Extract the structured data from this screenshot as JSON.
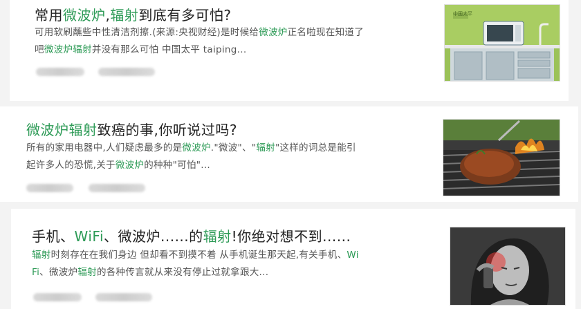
{
  "articles": [
    {
      "title_parts": [
        {
          "t": "常用",
          "hl": false
        },
        {
          "t": "微波炉",
          "hl": true
        },
        {
          "t": ",",
          "hl": false
        },
        {
          "t": "辐射",
          "hl": true
        },
        {
          "t": "到底有多可怕?",
          "hl": false
        }
      ],
      "snippet_lines": [
        [
          {
            "t": "可用软刷蘸些中性清洁剂擦.(来源:央视财经)是时候给",
            "hl": false
          },
          {
            "t": "微波炉",
            "hl": true
          },
          {
            "t": "正名啦现在知道了",
            "hl": false
          }
        ],
        [
          {
            "t": "吧",
            "hl": false
          },
          {
            "t": "微波炉辐射",
            "hl": true
          },
          {
            "t": "并没有那么可怕 中国太平 taiping...",
            "hl": false
          }
        ]
      ],
      "thumb_icon": "kitchen-microwave-image",
      "thumb_caption": "中国太平"
    },
    {
      "title_parts": [
        {
          "t": "微波炉辐射",
          "hl": true
        },
        {
          "t": "致癌的事,你听说过吗?",
          "hl": false
        }
      ],
      "snippet_lines": [
        [
          {
            "t": "所有的家用电器中,人们疑虑最多的是",
            "hl": false
          },
          {
            "t": "微波炉",
            "hl": true
          },
          {
            "t": ".\"微波\"、\"",
            "hl": false
          },
          {
            "t": "辐射",
            "hl": true
          },
          {
            "t": "\"这样的词总是能引",
            "hl": false
          }
        ],
        [
          {
            "t": "起许多人的恐慌,关于",
            "hl": false
          },
          {
            "t": "微波炉",
            "hl": true
          },
          {
            "t": "的种种\"可怕\"...",
            "hl": false
          }
        ]
      ],
      "thumb_icon": "grilled-steak-image"
    },
    {
      "title_parts": [
        {
          "t": "手机、",
          "hl": false
        },
        {
          "t": "WiFi",
          "hl": true
        },
        {
          "t": "、微波炉......的",
          "hl": false
        },
        {
          "t": "辐射",
          "hl": true
        },
        {
          "t": "!你绝对想不到......",
          "hl": false
        }
      ],
      "snippet_lines": [
        [
          {
            "t": "辐射",
            "hl": true
          },
          {
            "t": "时刻存在在我们身边 但却看不到摸不着 从手机诞生那天起,有关手机、",
            "hl": false
          },
          {
            "t": "Wi",
            "hl": true
          }
        ],
        [
          {
            "t": "Fi",
            "hl": true
          },
          {
            "t": "、微波炉",
            "hl": false
          },
          {
            "t": "辐射",
            "hl": true
          },
          {
            "t": "的各种传言就从来没有停止过就拿跟大...",
            "hl": false
          }
        ]
      ],
      "thumb_icon": "woman-on-phone-headache-image"
    }
  ],
  "colors": {
    "highlight": "#2e9b57",
    "title": "#222222",
    "snippet": "#555555"
  }
}
